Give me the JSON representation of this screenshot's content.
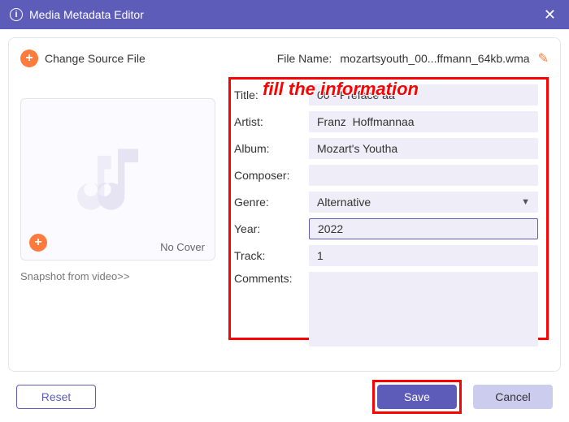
{
  "window": {
    "title": "Media Metadata Editor"
  },
  "toprow": {
    "change_source": "Change Source File",
    "file_name_label": "File Name:",
    "file_name_value": "mozartsyouth_00...ffmann_64kb.wma"
  },
  "annotation": "fill the information",
  "cover": {
    "no_cover": "No Cover",
    "snapshot": "Snapshot from video>>"
  },
  "form": {
    "title_label": "Title:",
    "title_value": "00 - Preface aa",
    "artist_label": "Artist:",
    "artist_value": "Franz  Hoffmannaa",
    "album_label": "Album:",
    "album_value": "Mozart's Youtha",
    "composer_label": "Composer:",
    "composer_value": "",
    "genre_label": "Genre:",
    "genre_value": "Alternative",
    "year_label": "Year:",
    "year_value": "2022",
    "track_label": "Track:",
    "track_value": "1",
    "comments_label": "Comments:",
    "comments_value": ""
  },
  "footer": {
    "reset": "Reset",
    "save": "Save",
    "cancel": "Cancel"
  }
}
